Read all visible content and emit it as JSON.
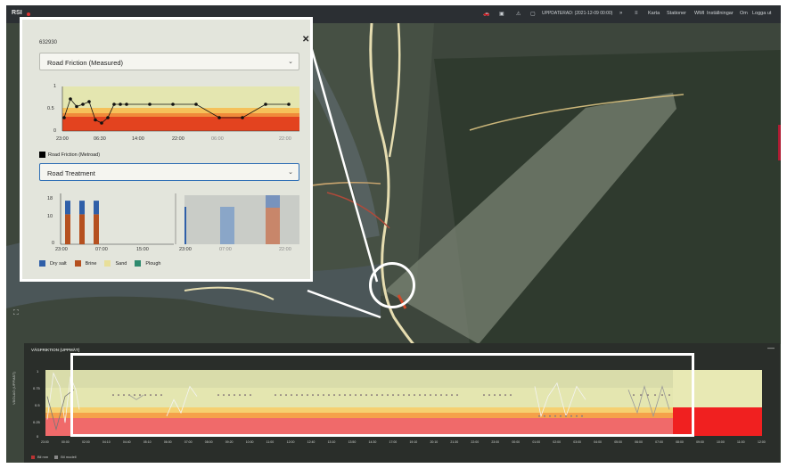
{
  "topbar": {
    "app_name": "RSI",
    "status_text": "UPPDATERAD: (2021-12-09 00:00)",
    "nav": [
      "Karta",
      "Stationer",
      "WMI",
      "Inställningar",
      "Om",
      "Logga ut"
    ]
  },
  "popup": {
    "station_id": "632930",
    "friction_select": "Road Friction (Measured)",
    "friction_legend": "Road Friction (Metroad)",
    "treatment_select": "Road Treatment",
    "friction_chart": {
      "y_ticks": [
        "1",
        "0.5",
        "0"
      ],
      "x_ticks": [
        "23:00",
        "06:30",
        "14:00",
        "22:00",
        "06:00",
        "22:00"
      ]
    },
    "treatment_chart": {
      "y_ticks": [
        "18",
        "10",
        "0"
      ],
      "x_ticks_left": [
        "23:00",
        "07:00",
        "15:00"
      ],
      "x_ticks_right": [
        "23:00",
        "07:00",
        "22:00"
      ]
    },
    "treatment_legend": [
      {
        "label": "Dry salt",
        "color": "#2f5fa8"
      },
      {
        "label": "Brine",
        "color": "#b5501f"
      },
      {
        "label": "Sand",
        "color": "#e8df9a"
      },
      {
        "label": "Plough",
        "color": "#2e8a6e"
      }
    ]
  },
  "bottom_panel": {
    "title": "VÄGFRIKTION (UPPMÄT)",
    "side_label": "VÄGLAG (UPPMÄT)",
    "y_ticks": [
      "1",
      "0.75",
      "0.5",
      "0.25",
      "0"
    ],
    "x_ticks": [
      "23:00",
      "00:00",
      "02:00",
      "04:10",
      "04:40",
      "05:10",
      "06:00",
      "07:00",
      "08:00",
      "09:20",
      "10:00",
      "11:00",
      "12:00",
      "12:40",
      "13:10",
      "13:50",
      "14:30",
      "17:00",
      "19:10",
      "20:10",
      "21:30",
      "22:00",
      "23:00",
      "00:00",
      "01:00",
      "02:00",
      "03:00",
      "04:00",
      "05:00",
      "06:00",
      "07:00",
      "08:00",
      "09:00",
      "10:00",
      "11:00",
      "12:00"
    ],
    "legend": [
      "Bil mm",
      "Bil modell"
    ]
  },
  "chart_data": [
    {
      "type": "line",
      "title": "",
      "xlabel": "",
      "ylabel": "",
      "ylim": [
        0,
        1
      ],
      "y_ticks": [
        0,
        0.5,
        1
      ],
      "series": [
        {
          "name": "Road Friction (Metroad)",
          "x": [
            "23:00",
            "00:00",
            "01:00",
            "01:30",
            "02:00",
            "02:30",
            "03:00",
            "03:30",
            "04:00",
            "05:00",
            "06:30",
            "14:00",
            "18:00",
            "20:00",
            "22:00",
            "02:00",
            "04:00",
            "05:00"
          ],
          "y": [
            0.3,
            0.72,
            0.55,
            0.6,
            0.66,
            0.25,
            0.18,
            0.3,
            0.6,
            0.6,
            0.6,
            0.6,
            0.6,
            0.6,
            0.3,
            0.3,
            0.6,
            0.6
          ]
        }
      ]
    },
    {
      "type": "bar",
      "title": "",
      "categories": [
        "23:00",
        "01:00",
        "03:00",
        "04:00",
        "05:00"
      ],
      "ylim": [
        0,
        18
      ],
      "series": [
        {
          "name": "Dry salt",
          "values": [
            5,
            0,
            5,
            0,
            5
          ]
        },
        {
          "name": "Brine",
          "values": [
            11,
            0,
            11,
            0,
            11
          ]
        }
      ]
    }
  ]
}
